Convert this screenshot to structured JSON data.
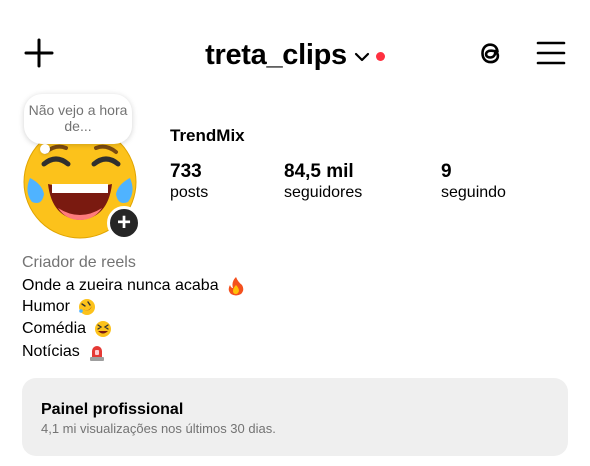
{
  "header": {
    "username": "treta_clips",
    "icons": [
      "plus-icon",
      "chevron-down-icon",
      "threads-icon",
      "menu-icon"
    ],
    "notification_dot_color": "#ff3040"
  },
  "profile": {
    "note": "Não vejo a hora de...",
    "display_name": "TrendMix",
    "stats": [
      {
        "value": "733",
        "label": "posts"
      },
      {
        "value": "84,5 mil",
        "label": "seguidores"
      },
      {
        "value": "9",
        "label": "seguindo"
      }
    ],
    "category": "Criador de reels",
    "bio_lines": [
      {
        "text": "Onde a zueira nunca acaba",
        "emoji": "fire-icon"
      },
      {
        "text": "Humor",
        "emoji": "rolling-laughing-icon"
      },
      {
        "text": "Comédia",
        "emoji": "grinning-squint-icon"
      },
      {
        "text": "Notícias",
        "emoji": "police-light-icon"
      }
    ]
  },
  "dashboard": {
    "title": "Painel profissional",
    "subtitle": "4,1 mi visualizações nos últimos 30 dias."
  },
  "colors": {
    "secondary_text": "#737373",
    "dashboard_bg": "#efefef",
    "avatar_yellow": "#fcc21b"
  }
}
